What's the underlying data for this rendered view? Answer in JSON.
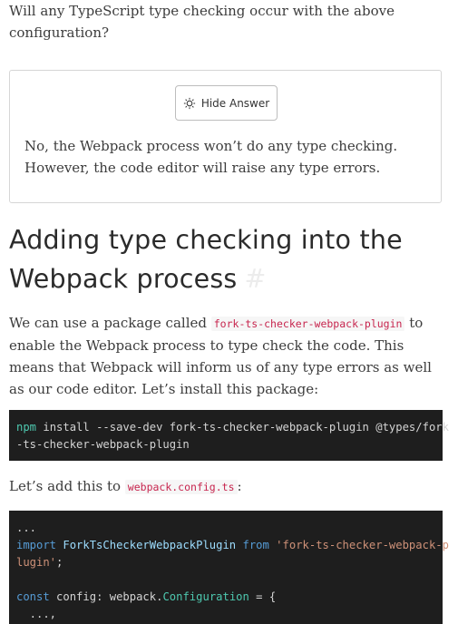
{
  "question": {
    "text": "Will any TypeScript type checking occur with the above configuration?"
  },
  "answer": {
    "button_label": "Hide Answer",
    "text": "No, the Webpack process won’t do any type checking. However, the code editor will raise any type errors."
  },
  "section": {
    "heading": "Adding type checking into the Webpack process",
    "anchor": "#"
  },
  "para2": {
    "before": "We can use a package called ",
    "code": "fork-ts-checker-webpack-plugin",
    "after": " to enable the Webpack process to type check the code. This means that Webpack will inform us of any type errors as well as our code editor. Let’s install this package:"
  },
  "code1": {
    "cmd": "npm",
    "install": " install ",
    "flag": "--save-dev",
    "pkg": " fork-ts-checker-webpack-plugin ",
    "types": "@types/fork",
    "line2": "-ts-checker-webpack-plugin"
  },
  "para3": {
    "before": "Let’s add this to ",
    "code": "webpack.config.ts",
    "after": ":"
  },
  "code2": {
    "l1": "...",
    "import_kw": "import",
    "import_name": " ForkTsCheckerWebpackPlugin ",
    "from_kw": "from",
    "import_str1": " 'fork-ts-checker-webpack-p",
    "import_str2": "lugin'",
    "semi": ";",
    "const_kw": "const",
    "config_name": " config",
    "colon": ": ",
    "webpack": "webpack.",
    "conf_type": "Configuration",
    "eq": " = {",
    "dots": "  ...,"
  }
}
